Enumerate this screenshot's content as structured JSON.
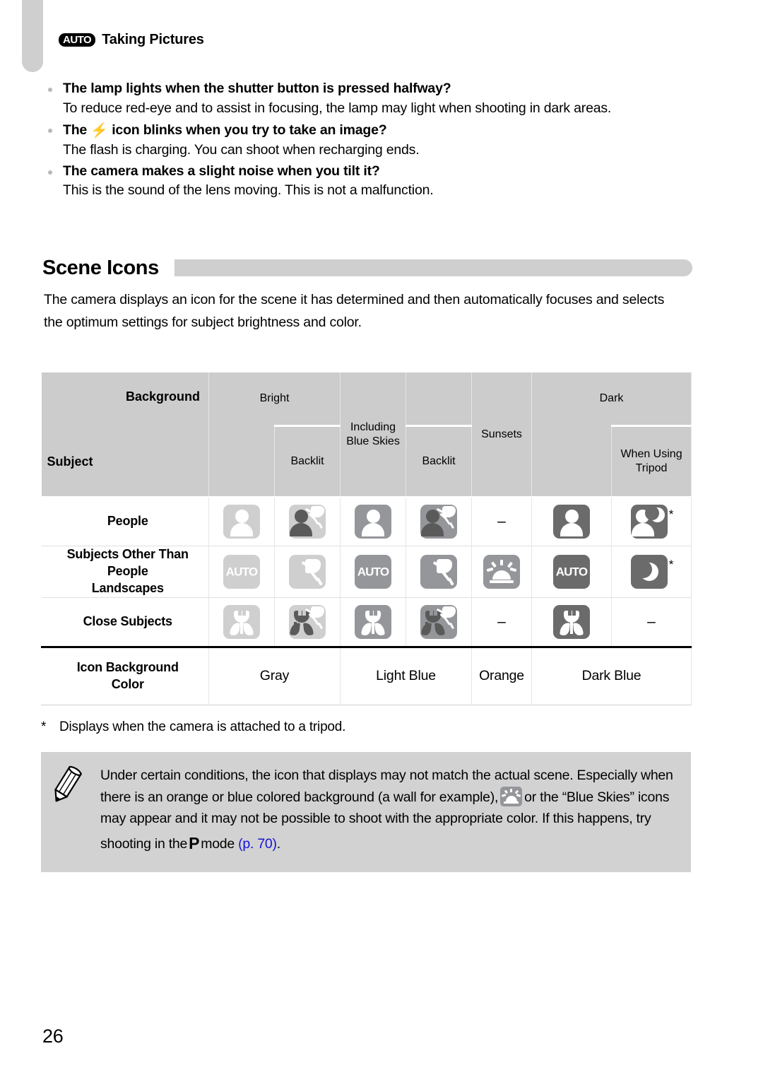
{
  "chapter_tab": "chapter-index-tab",
  "header": {
    "mode_badge": "AUTO",
    "title": "Taking Pictures"
  },
  "qa": [
    {
      "question": "The lamp lights when the shutter button is pressed halfway?",
      "answer": "To reduce red-eye and to assist in focusing, the lamp may light when shooting in dark areas."
    },
    {
      "question_before": "The",
      "question_icon": "flash-icon",
      "question_after": "icon blinks when you try to take an image?",
      "answer": "The flash is charging. You can shoot when recharging ends."
    },
    {
      "question": "The camera makes a slight noise when you tilt it?",
      "answer": "This is the sound of the lens moving. This is not a malfunction."
    }
  ],
  "section": {
    "title": "Scene Icons",
    "intro": "The camera displays an icon for the scene it has determined and then automatically focuses and selects the optimum settings for subject brightness and color."
  },
  "table": {
    "corner": {
      "background_label": "Background",
      "subject_label": "Subject"
    },
    "groups": [
      {
        "label": "Bright",
        "sub": [
          "",
          "Backlit"
        ]
      },
      {
        "label": "Including Blue Skies",
        "sub": [
          "",
          "Backlit"
        ]
      },
      {
        "label": "Sunsets",
        "sub": []
      },
      {
        "label": "Dark",
        "sub": [
          "",
          "When Using Tripod"
        ]
      }
    ],
    "sunsets_label": "Sunsets",
    "dark_tripod_label": "When Using Tripod",
    "rows": [
      {
        "label": "People",
        "cells": [
          {
            "icon": "person-icon",
            "shade": "lite",
            "fill": "white",
            "backlit": false
          },
          {
            "icon": "person-backlit-icon",
            "shade": "lite",
            "fill": "dark",
            "backlit": true
          },
          {
            "icon": "person-icon",
            "shade": "mid",
            "fill": "white",
            "backlit": false
          },
          {
            "icon": "person-backlit-icon",
            "shade": "mid",
            "fill": "dark",
            "backlit": true
          },
          {
            "icon": "none",
            "text": "–"
          },
          {
            "icon": "person-icon",
            "shade": "dark",
            "fill": "white",
            "backlit": false
          },
          {
            "icon": "person-night-icon",
            "shade": "dark",
            "fill": "white",
            "backlit": false,
            "moon": true,
            "asterisk": "*"
          }
        ]
      },
      {
        "label": "Subjects Other Than People\nLandscapes",
        "label_lines": [
          "Subjects Other Than",
          "People",
          "Landscapes"
        ],
        "cells": [
          {
            "icon": "auto-icon",
            "shade": "lite"
          },
          {
            "icon": "sun-backlit-icon",
            "shade": "lite"
          },
          {
            "icon": "auto-icon",
            "shade": "mid"
          },
          {
            "icon": "sun-backlit-icon",
            "shade": "mid"
          },
          {
            "icon": "sunset-icon",
            "shade": "mid"
          },
          {
            "icon": "auto-icon",
            "shade": "dark"
          },
          {
            "icon": "moon-icon",
            "shade": "dark",
            "asterisk": "*"
          }
        ]
      },
      {
        "label": "Close Subjects",
        "cells": [
          {
            "icon": "macro-flower-icon",
            "shade": "lite",
            "fill": "white",
            "backlit": false
          },
          {
            "icon": "macro-flower-backlit-icon",
            "shade": "lite",
            "fill": "dark",
            "backlit": true
          },
          {
            "icon": "macro-flower-icon",
            "shade": "mid",
            "fill": "white",
            "backlit": false
          },
          {
            "icon": "macro-flower-backlit-icon",
            "shade": "mid",
            "fill": "dark",
            "backlit": true
          },
          {
            "icon": "none",
            "text": "–"
          },
          {
            "icon": "macro-flower-icon",
            "shade": "dark",
            "fill": "white",
            "backlit": false
          },
          {
            "icon": "none",
            "text": "–"
          }
        ]
      }
    ],
    "color_row": {
      "label_lines": [
        "Icon Background",
        "Color"
      ],
      "values": [
        "Gray",
        "Light Blue",
        "Orange",
        "Dark Blue"
      ]
    }
  },
  "footnote": {
    "mark": "*",
    "text": "Displays when the camera is attached to a tripod."
  },
  "note": {
    "icon": "pencil-icon",
    "part1": "Under certain conditions, the icon that displays may not match the actual scene. Especially when there is an orange or blue colored background (a wall for example),",
    "inline_icon": "sunset-icon",
    "part2": "or the “Blue Skies” icons may appear and it may not be possible to shoot with the appropriate color. If this happens, try shooting in the",
    "mode_symbol": "P",
    "part3": "mode",
    "link": "(p. 70)",
    "part4": "."
  },
  "page_number": "26",
  "colors": {
    "header_fill": "#cccccc",
    "note_fill": "#d2d2d2",
    "icon_light": "#cfcfcf",
    "icon_mid": "#949699",
    "icon_dark": "#6b6b6b",
    "link": "#1414d8"
  }
}
